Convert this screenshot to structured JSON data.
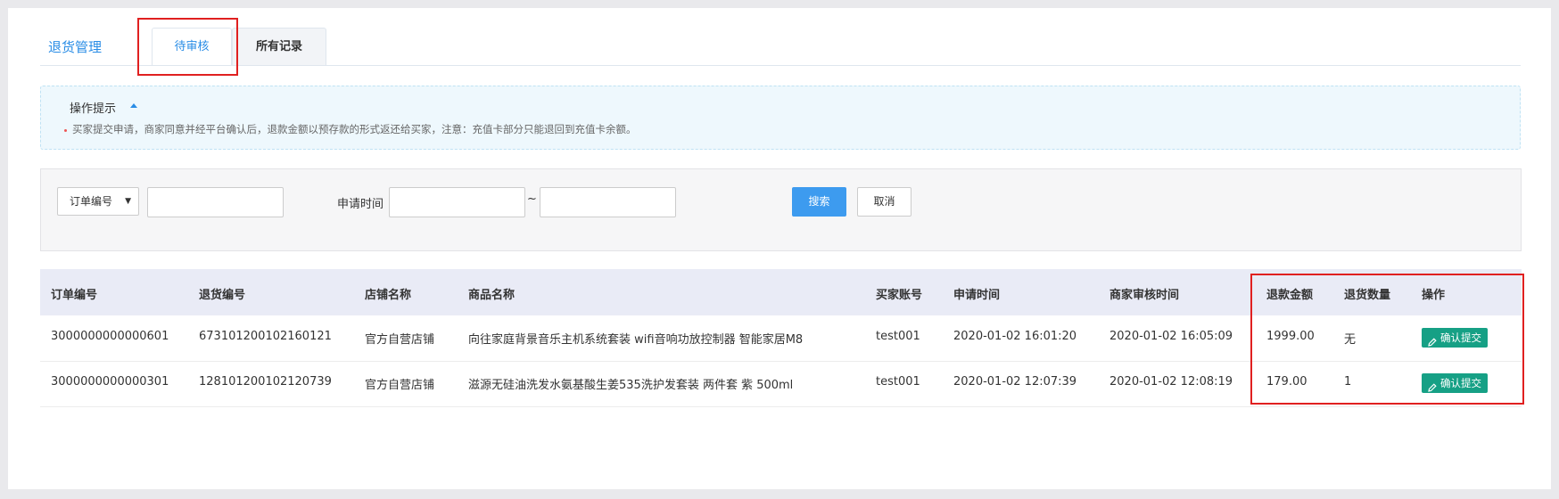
{
  "header": {
    "title": "退货管理",
    "tabs": [
      {
        "label": "待审核",
        "active": true
      },
      {
        "label": "所有记录",
        "active": false
      }
    ]
  },
  "tips": {
    "title": "操作提示",
    "text": "买家提交申请，商家同意并经平台确认后，退款金额以预存款的形式返还给买家，注意：充值卡部分只能退回到充值卡余额。"
  },
  "search": {
    "select_value": "订单编号",
    "order_input": "",
    "time_label": "申请时间",
    "time_separator": "~",
    "start_time": "",
    "end_time": "",
    "search_label": "搜索",
    "cancel_label": "取消"
  },
  "table": {
    "columns": [
      "订单编号",
      "退货编号",
      "店铺名称",
      "商品名称",
      "买家账号",
      "申请时间",
      "商家审核时间",
      "退款金额",
      "退货数量",
      "操作"
    ],
    "rows": [
      {
        "order_no": "3000000000000601",
        "return_no": "673101200102160121",
        "store": "官方自营店铺",
        "product": "向往家庭背景音乐主机系统套装 wifi音响功放控制器 智能家居M8",
        "buyer": "test001",
        "apply_time": "2020-01-02 16:01:20",
        "review_time": "2020-01-02 16:05:09",
        "refund_amount": "1999.00",
        "return_qty": "无",
        "action": "确认提交"
      },
      {
        "order_no": "3000000000000301",
        "return_no": "128101200102120739",
        "store": "官方自营店铺",
        "product": "滋源无硅油洗发水氨基酸生姜535洗护发套装 两件套 紫 500ml",
        "buyer": "test001",
        "apply_time": "2020-01-02 12:07:39",
        "review_time": "2020-01-02 12:08:19",
        "refund_amount": "179.00",
        "return_qty": "1",
        "action": "确认提交"
      }
    ]
  },
  "colors": {
    "accent": "#2a8de6",
    "highlight": "#e02020",
    "action_button": "#16a085",
    "search_button": "#3d9bef"
  }
}
